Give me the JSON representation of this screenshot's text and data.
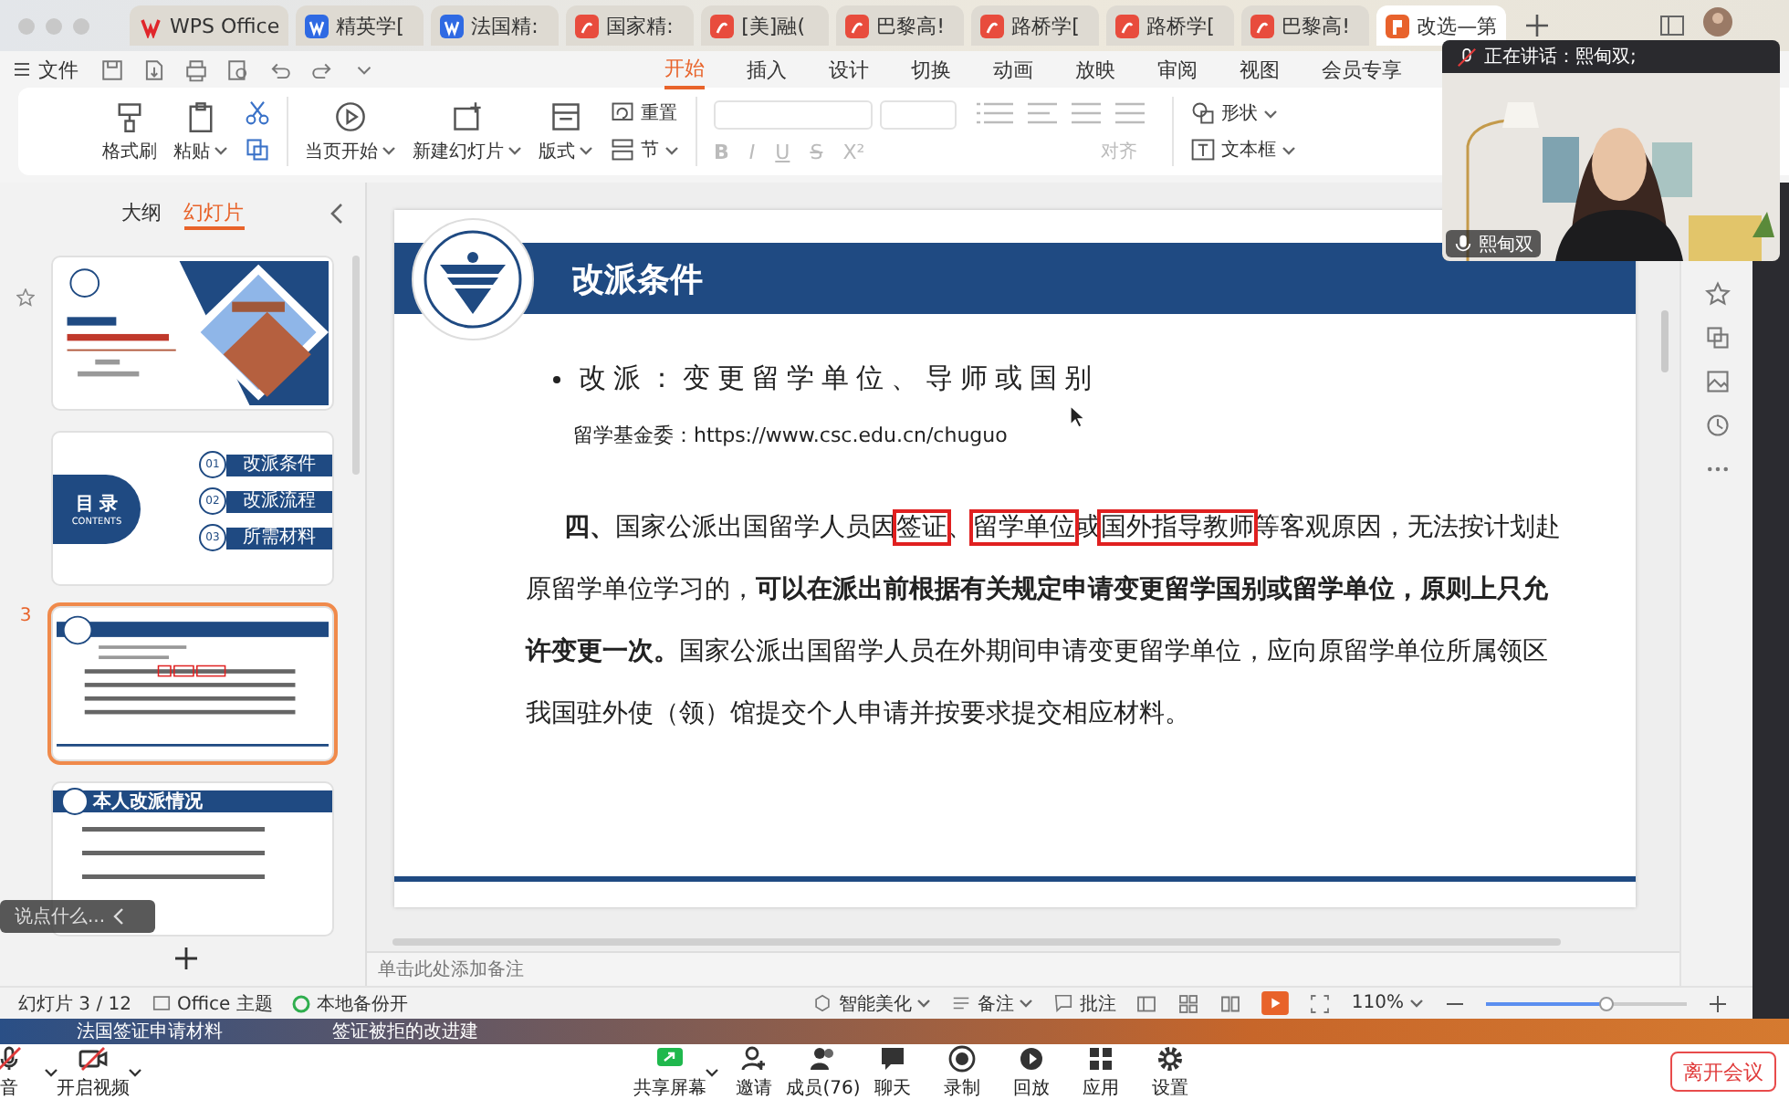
{
  "browser_tabs": [
    {
      "label": "WPS Office",
      "kind": "wps",
      "selected": false
    },
    {
      "label": "精英学[",
      "kind": "writer",
      "selected": false
    },
    {
      "label": "法国精:",
      "kind": "writer",
      "selected": false
    },
    {
      "label": "国家精:",
      "kind": "pdf",
      "selected": false
    },
    {
      "label": "[美]融(",
      "kind": "pdf",
      "selected": false
    },
    {
      "label": "巴黎高!",
      "kind": "pdf",
      "selected": false
    },
    {
      "label": "路桥学[",
      "kind": "pdf",
      "selected": false
    },
    {
      "label": "路桥学[",
      "kind": "pdf",
      "selected": false
    },
    {
      "label": "巴黎高!",
      "kind": "pdf",
      "selected": false
    },
    {
      "label": "改选—第",
      "kind": "ppt",
      "selected": true
    }
  ],
  "menu": {
    "file": "文件",
    "tabs": [
      {
        "label": "开始",
        "selected": true
      },
      {
        "label": "插入",
        "selected": false
      },
      {
        "label": "设计",
        "selected": false
      },
      {
        "label": "切换",
        "selected": false
      },
      {
        "label": "动画",
        "selected": false
      },
      {
        "label": "放映",
        "selected": false
      },
      {
        "label": "审阅",
        "selected": false
      },
      {
        "label": "视图",
        "selected": false
      },
      {
        "label": "会员专享",
        "selected": false
      }
    ]
  },
  "ribbon": {
    "tools": [
      {
        "kind": "brush",
        "label": "格式刷",
        "menu": false
      },
      {
        "kind": "paste",
        "label": "粘贴",
        "menu": true
      },
      {
        "kind": "clipboard-tools"
      },
      {
        "kind": "play",
        "label": "当页开始",
        "menu": true
      },
      {
        "kind": "newslide",
        "label": "新建幻灯片",
        "menu": true
      },
      {
        "kind": "layout",
        "label": "版式",
        "menu": true
      },
      {
        "kind": "reset",
        "label": "重置",
        "menu": false
      },
      {
        "kind": "section",
        "label": "节",
        "menu": true
      },
      {
        "kind": "font-panel",
        "marks": [
          "B",
          "I",
          "U",
          "S",
          "X²"
        ],
        "label": "对齐"
      },
      {
        "kind": "shape",
        "label": "形状",
        "menu": true
      },
      {
        "kind": "textbox",
        "label": "文本框",
        "menu": true
      }
    ]
  },
  "webcam": {
    "speaking": "正在讲话：熙甸双;",
    "name": "熙甸双"
  },
  "slides_panel": {
    "tabs": [
      {
        "label": "大纲",
        "selected": false
      },
      {
        "label": "幻灯片",
        "selected": true
      }
    ],
    "slides": [
      {
        "kind": "cover",
        "starred": true,
        "selected": false
      },
      {
        "kind": "contents",
        "starred": false,
        "selected": false,
        "title": "目 录",
        "subtitle": "CONTENTS",
        "items": [
          {
            "num": "01",
            "label": "改派条件"
          },
          {
            "num": "02",
            "label": "改派流程"
          },
          {
            "num": "03",
            "label": "所需材料"
          }
        ]
      },
      {
        "kind": "text",
        "starred": false,
        "selected": true,
        "number": "3"
      },
      {
        "kind": "list",
        "starred": false,
        "selected": false,
        "title": "本人改派情况"
      }
    ]
  },
  "chat_prompt": "说点什么...",
  "slide": {
    "title": "改派条件",
    "bullet": "改派：变更留学单位、导师或国别",
    "source": "留学基金委：https://www.csc.edu.cn/chuguo",
    "paragraph": [
      {
        "text": "四、",
        "bold": true,
        "boxed": false
      },
      {
        "text": "国家公派出国留学人员因",
        "bold": false,
        "boxed": false
      },
      {
        "text": "签证",
        "bold": false,
        "boxed": true
      },
      {
        "text": "、",
        "bold": false,
        "boxed": false
      },
      {
        "text": "留学单位",
        "bold": false,
        "boxed": true
      },
      {
        "text": "或",
        "bold": false,
        "boxed": false
      },
      {
        "text": "国外指导教师",
        "bold": false,
        "boxed": true
      },
      {
        "text": "等客观原因，无法按计划赴原留学单位学习的，",
        "bold": false,
        "boxed": false
      },
      {
        "text": "可以在派出前根据有关规定申请变更留学国别或留学单位，原则上只允许变更一次。",
        "bold": true,
        "boxed": false
      },
      {
        "text": "国家公派出国留学人员在外期间申请变更留学单位，应向原留学单位所属领区我国驻外使（领）馆提交个人申请并按要求提交相应材料。",
        "bold": false,
        "boxed": false
      }
    ]
  },
  "notes_placeholder": "单击此处添加备注",
  "status_bar": {
    "slide_counter": "幻灯片 3 / 12",
    "theme": "Office 主题",
    "backup": "本地备份开",
    "beautify": "智能美化",
    "notes": "备注",
    "comments": "批注",
    "zoom": "110%",
    "level": 0.6
  },
  "desktop_items": [
    "法国签证申请材料",
    "签证被拒的改进建"
  ],
  "meeting": {
    "left": [
      {
        "label": "音",
        "kind": "mic"
      },
      {
        "label": "开启视频",
        "kind": "camera"
      }
    ],
    "center": [
      {
        "label": "共享屏幕",
        "kind": "share"
      },
      {
        "label": "邀请",
        "kind": "invite"
      },
      {
        "label": "成员(76)",
        "kind": "members"
      },
      {
        "label": "聊天",
        "kind": "chat"
      },
      {
        "label": "录制",
        "kind": "record"
      },
      {
        "label": "回放",
        "kind": "replay"
      },
      {
        "label": "应用",
        "kind": "apps"
      },
      {
        "label": "设置",
        "kind": "settings"
      }
    ],
    "leave": "离开会议"
  }
}
